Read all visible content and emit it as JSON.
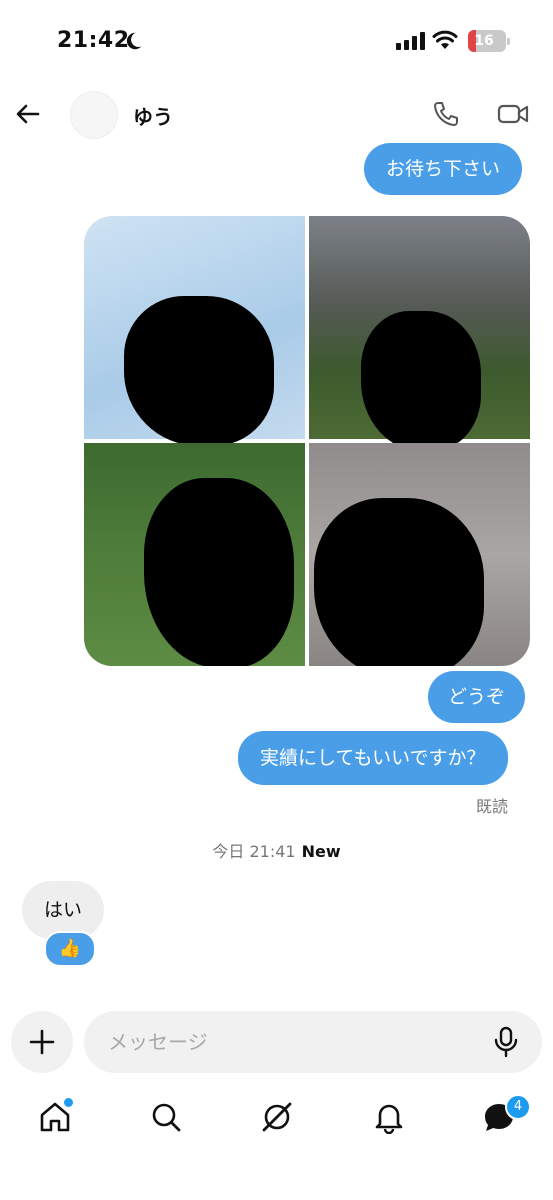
{
  "status_bar": {
    "time": "21:42",
    "battery": "16"
  },
  "header": {
    "contact_name": "ゆう"
  },
  "messages": {
    "out_1": "お待ち下さい",
    "out_2": "どうぞ",
    "out_3": "実績にしてもいいですか？",
    "read_receipt": "既読",
    "date_separator": "今日 21:41",
    "new_label": "New",
    "in_1": "はい",
    "reaction": "👍"
  },
  "composer": {
    "placeholder": "メッセージ"
  },
  "tab_bar": {
    "messages_badge": "4"
  },
  "colors": {
    "accent": "#1d9bf0",
    "outgoing_bubble": "#4a9ee8",
    "incoming_bubble": "#eeeeee"
  }
}
